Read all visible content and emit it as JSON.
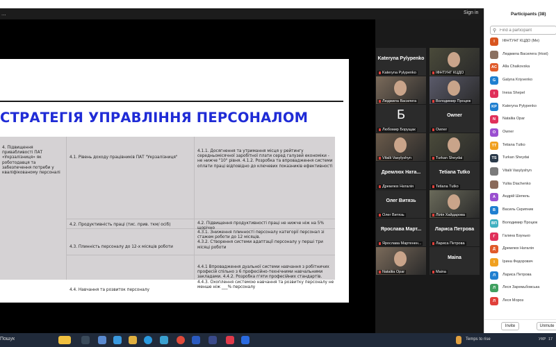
{
  "zoom": {
    "menu_dots": "...",
    "sign_in": "Sign in"
  },
  "slide": {
    "title": "СТРАТЕГІЯ УПРАВЛІННЯ ПЕРСОНАЛОМ",
    "goal": "4. Підвищення привабливості ПАТ «Укрзалізниця» як роботодавця та забезпечення потреби у кваліфікованому персоналі",
    "rows": [
      {
        "objective": "4.1. Рівень доходу працівників ПАТ \"Укрзалізниця\"",
        "tasks": "4.1.1. Досягнення та утримання місця у рейтингу середньомісячної заробітної плати серед галузей економіки - не нижче \"10\" рівня. 4.1.2. Розробка та впровадження системи оплати праці відповідно до ключевих показників ефективності"
      },
      {
        "objective": "4.2. Продуктивність праці (тис. прив. ткм/ осіб)",
        "tasks": "4.2. Підвищення продуктивності праці не нижче ніж на 5% щорічно"
      },
      {
        "objective": "4.3. Плинність персоналу до 12-х місяців роботи",
        "tasks": "4.3.1. Зниження плинності персоналу категорії персонал зі стажем роботи до 12 місяців.\n4.3.2. Створення системи адаптації персоналу у перші три місяці роботи"
      },
      {
        "objective": "4.4. Навчання та розвиток персоналу",
        "tasks": "4.4.1 Впровадження дуальної системи навчання з робітничих професій спільно з 6 професійно-технічними навчальними закладами.                                          4.4.2. Розробка п'яти  професійних стандартів.\n4.4.3. Охоплення системою навчання та розвитку персоналу не менше ніж ___% персоналу"
      }
    ]
  },
  "tiles": [
    {
      "name": "Kateryna  Pylypenko",
      "label": "Kateryna Pylypenko",
      "video": false
    },
    {
      "name": "",
      "label": "ІФНТУНГ КЦДО",
      "video": true
    },
    {
      "name": "",
      "label": "Людмила Василега",
      "video": true,
      "active": true
    },
    {
      "name": "",
      "label": "Володимир Процюк",
      "video": true
    },
    {
      "name": "Б",
      "label": "Любомир Борущак",
      "video": false,
      "letter": true
    },
    {
      "name": "Owner",
      "label": "Owner",
      "video": false
    },
    {
      "name": "",
      "label": "Vitalii Vasylyshyn",
      "video": true
    },
    {
      "name": "",
      "label": "Turkan Sheydai",
      "video": true
    },
    {
      "name": "Дремлюх  Ната...",
      "label": "Дремлюх Наталія",
      "video": false
    },
    {
      "name": "Tetiana Tutko",
      "label": "Tetiana Tutko",
      "video": false
    },
    {
      "name": "Олег Витязь",
      "label": "Олег Витязь",
      "video": false
    },
    {
      "name": "",
      "label": "Лілія Хайдарова",
      "video": true
    },
    {
      "name": "Ярослава  Март...",
      "label": "Ярослава Мартенен...",
      "video": false
    },
    {
      "name": "Лариса Петрова",
      "label": "Лариса Петрова",
      "video": false
    },
    {
      "name": "",
      "label": "Nataliia Opar",
      "video": true
    },
    {
      "name": "Maina",
      "label": "Maina",
      "video": false
    }
  ],
  "participants": {
    "title": "Participants (38)",
    "search_placeholder": "Find a participant",
    "list": [
      {
        "initials": "І",
        "name": "ІФНТУНГ КЦДО (Me)",
        "color": "#d8551f"
      },
      {
        "initials": "",
        "name": "Людмила Василега (Host)",
        "color": "#8a7060"
      },
      {
        "initials": "AC",
        "name": "Alla Chaikovska",
        "color": "#e05a2a"
      },
      {
        "initials": "G",
        "name": "Galyna Kriyvenko",
        "color": "#1f7fd0"
      },
      {
        "initials": "I",
        "name": "Inesa Shepel",
        "color": "#e0305a"
      },
      {
        "initials": "KP",
        "name": "Kateryna Pylypenko",
        "color": "#1f7fd0"
      },
      {
        "initials": "N",
        "name": "Nataliia Opar",
        "color": "#e0305a"
      },
      {
        "initials": "O",
        "name": "Owner",
        "color": "#9a4fd0"
      },
      {
        "initials": "TT",
        "name": "Tetiana Tutko",
        "color": "#f0a020"
      },
      {
        "initials": "TS",
        "name": "Turkan Sheydai",
        "color": "#2a3a4a"
      },
      {
        "initials": "",
        "name": "Vitalii Vasylyshyn",
        "color": "#7a7a7a"
      },
      {
        "initials": "",
        "name": "Yuliia Diachenko",
        "color": "#8a6a5a"
      },
      {
        "initials": "А",
        "name": "Андрій Шепель",
        "color": "#9a4fd0"
      },
      {
        "initials": "В",
        "name": "Василь Скрипник",
        "color": "#1f7fd0"
      },
      {
        "initials": "ВП",
        "name": "Володимир Процюк",
        "color": "#40b0c0"
      },
      {
        "initials": "Г",
        "name": "Галина Бзунько",
        "color": "#e0305a"
      },
      {
        "initials": "Д",
        "name": "Дремлюх Наталія",
        "color": "#e05a2a"
      },
      {
        "initials": "І",
        "name": "Ірина Федорович",
        "color": "#f0a020"
      },
      {
        "initials": "Л",
        "name": "Лариса Петрова",
        "color": "#1f7fd0"
      },
      {
        "initials": "Л",
        "name": "Леся Заремьбовська",
        "color": "#40a060"
      },
      {
        "initials": "Л",
        "name": "Леся Мороз",
        "color": "#e0403a"
      }
    ],
    "invite": "Invite",
    "mute_all": "Unmute"
  },
  "taskbar": {
    "search": "Пошук",
    "weather": "Temps to rise",
    "lang": "УКР",
    "time": "17"
  }
}
